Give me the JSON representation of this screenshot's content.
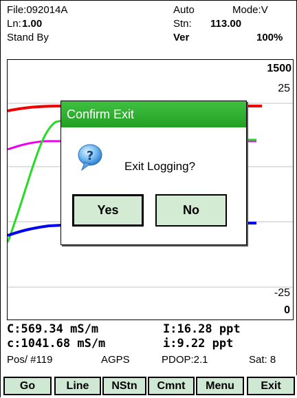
{
  "header": {
    "file": "File:092014A",
    "auto": "Auto",
    "mode": "Mode:V",
    "ln_label": "Ln:",
    "ln_value": "1.00",
    "stn_label": "Stn:",
    "stn_value": "113.00",
    "status": "Stand By",
    "ver": "Ver",
    "percent": "100%"
  },
  "plot": {
    "tick_top_right": "1500",
    "tick_upper": "25",
    "tick_lower": "-25",
    "tick_bottom": "0",
    "colors": {
      "red": "#ee0000",
      "green": "#22dd22",
      "magenta": "#ee00ee",
      "blue": "#0000ee",
      "grid": "#c0c0c0"
    }
  },
  "readouts": {
    "c_upper": "C:569.34  mS/m",
    "i_upper": "I:16.28  ppt",
    "c_lower": "c:1041.68 mS/m",
    "i_lower": "i:9.22   ppt",
    "pos": "Pos/ #119",
    "agps": "AGPS",
    "pdop": "PDOP:2.1",
    "sat": "Sat: 8"
  },
  "softkeys": [
    "Go",
    "Line",
    "NStn",
    "Cmnt",
    "Menu",
    "Exit"
  ],
  "dialog": {
    "title": "Confirm Exit",
    "icon": "question-icon",
    "message": "Exit Logging?",
    "yes_label": "Yes",
    "no_label": "No"
  }
}
